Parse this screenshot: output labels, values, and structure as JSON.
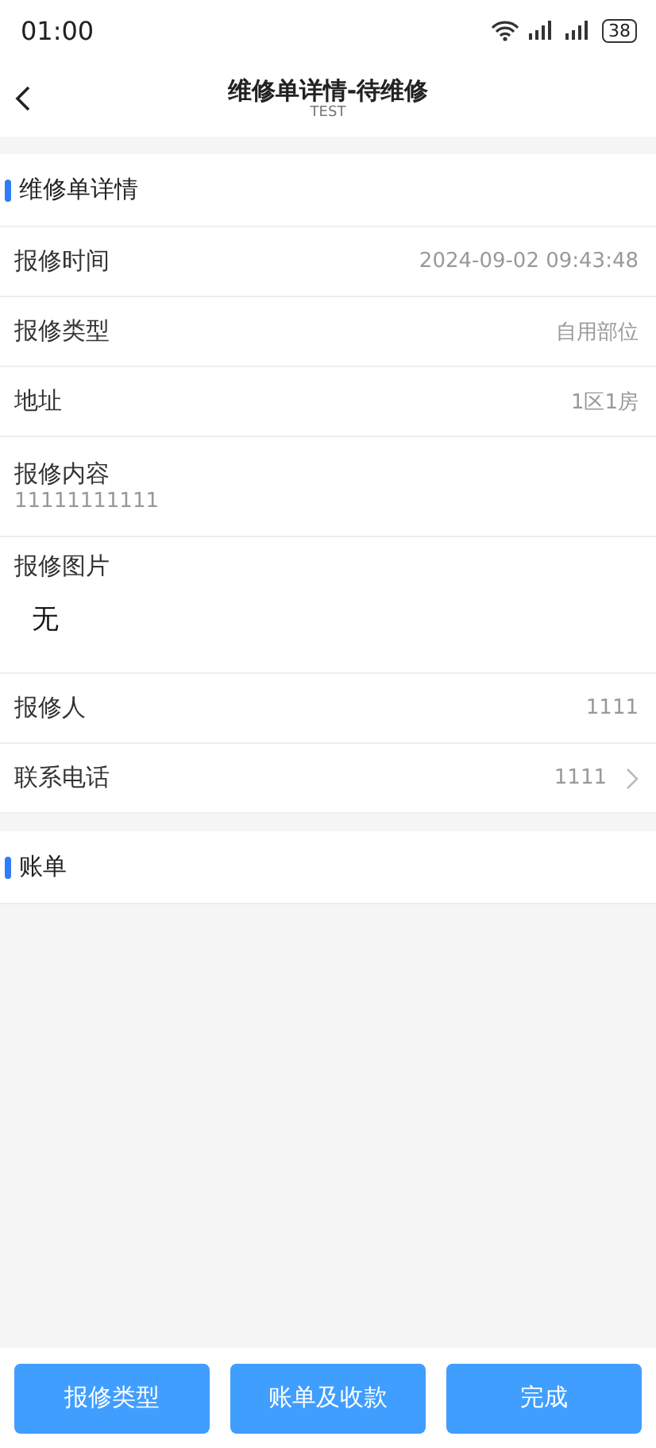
{
  "status_bar": {
    "time": "01:00",
    "battery": "38"
  },
  "header": {
    "title": "维修单详情-待维修",
    "subtitle": "TEST"
  },
  "details": {
    "title": "维修单详情",
    "rows": [
      {
        "kind": "inline",
        "label": "报修时间",
        "value": "2024-09-02 09:43:48"
      },
      {
        "kind": "inline",
        "label": "报修类型",
        "value": "自用部位"
      },
      {
        "kind": "inline",
        "label": "地址",
        "value": "1区1房"
      },
      {
        "kind": "stacked",
        "label": "报修内容",
        "value": "11111111111"
      },
      {
        "kind": "photos",
        "label": "报修图片",
        "value": "无"
      },
      {
        "kind": "inline",
        "label": "报修人",
        "value": "1111"
      },
      {
        "kind": "link",
        "label": "联系电话",
        "value": "1111"
      }
    ]
  },
  "bill": {
    "title": "账单"
  },
  "buttons": [
    "报修类型",
    "账单及收款",
    "完成"
  ]
}
